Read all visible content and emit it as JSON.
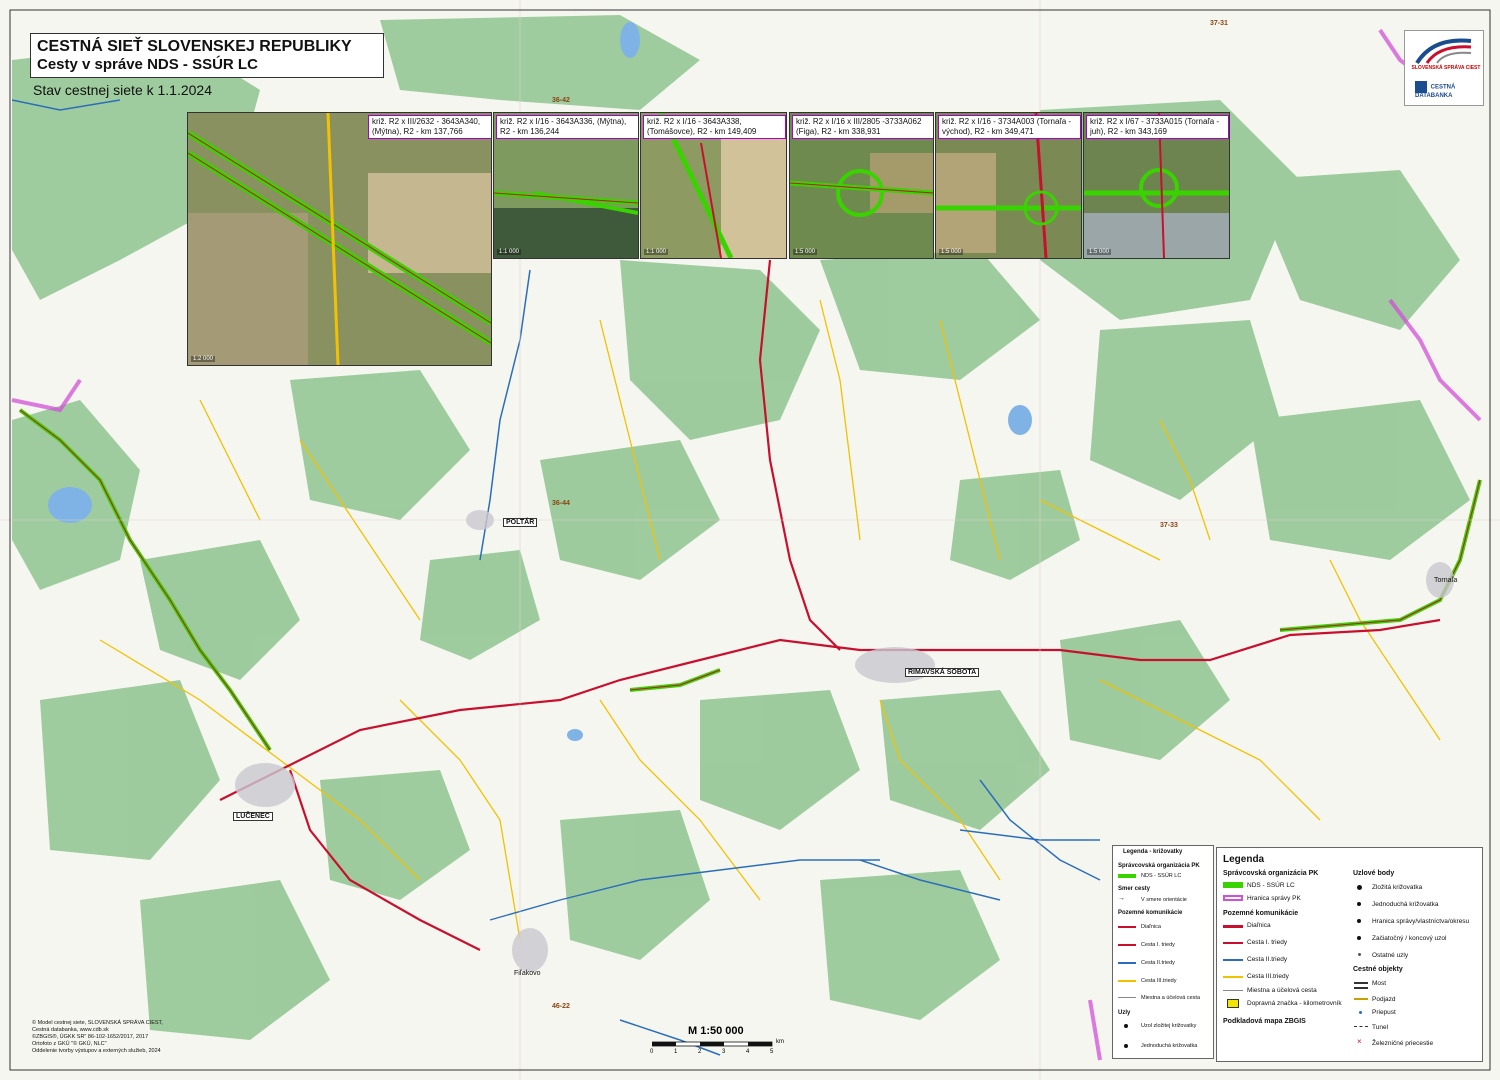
{
  "title": {
    "line1": "CESTNÁ SIEŤ SLOVENSKEJ REPUBLIKY",
    "line2": "Cesty v správe NDS - SSÚR LC",
    "status": "Stav cestnej siete k 1.1.2024"
  },
  "logos": {
    "ssc_text": "SLOVENSKÁ SPRÁVA CIEST",
    "cdb_text": "CESTNÁ DATABANKA"
  },
  "insets": [
    {
      "label": "križ. R2 x III/2632 - 3643A340, (Mýtna), R2 - km 137,766",
      "scale": "1:2 000"
    },
    {
      "label": "križ. R2 x I/16 - 3643A336, (Mýtna), R2 - km 136,244",
      "scale": "1:1 000"
    },
    {
      "label": "križ. R2 x I/16 - 3643A338, (Tomášovce), R2 - km 149,409",
      "scale": "1:1 000"
    },
    {
      "label": "križ. R2 x I/16 x III/2805 -3733A062 (Figa), R2 - km 338,931",
      "scale": "1:5 000"
    },
    {
      "label": "križ. R2 x I/16 - 3734A003 (Tornaľa - východ), R2 - km 349,471",
      "scale": "1:5 000"
    },
    {
      "label": "križ. R2 x I/67 - 3733A015 (Tornaľa - juh), R2 - km 343,169",
      "scale": "1:5 000"
    }
  ],
  "towns": {
    "poltar": "POLTÁR",
    "rimavska": "RIMAVSKÁ SOBOTA",
    "lucenec": "LUČENEC",
    "filakovo": "Fiľakovo",
    "tornala": "Tornaľa"
  },
  "grid_labels": [
    "36-42",
    "36-44",
    "37-31",
    "37-33",
    "46-22"
  ],
  "legend_small": {
    "title": "Legenda - križovatky",
    "org_header": "Správcovská organizácia PK",
    "org_item": "NDS - SSÚR LC",
    "dir_header": "Smer cesty",
    "dir_item": "V smere orientácie",
    "roads_header": "Pozemné komunikácie",
    "road_items": [
      "Diaľnica",
      "Cesta I. triedy",
      "Cesta II.triedy",
      "Cesta III.triedy",
      "Miestna a účelová cesta"
    ],
    "nodes_header": "Uzly",
    "node_items": [
      "Uzol zložitej križovatky",
      "Jednoduchá križovatka"
    ]
  },
  "legend_big": {
    "title": "Legenda",
    "org_header": "Správcovská organizácia PK",
    "org_items": [
      "NDS - SSÚR LC",
      "Hranica správy PK"
    ],
    "roads_header": "Pozemné komunikácie",
    "road_items": [
      "Diaľnica",
      "Cesta I. triedy",
      "Cesta II.triedy",
      "Cesta III.triedy",
      "Miestna a účelová cesta",
      "Dopravná značka - kilometrovník"
    ],
    "base_map": "Podkladová mapa ZBGIS",
    "nodes_header": "Uzlové body",
    "node_items": [
      "Zložitá križovatka",
      "Jednoduchá križovatka",
      "Hranica správy/vlastníctva/okresu",
      "Začiatočný / koncový uzol",
      "Ostatné uzly"
    ],
    "objects_header": "Cestné objekty",
    "object_items": [
      "Most",
      "Podjazd",
      "Priepust",
      "Tunel",
      "Železničné priecestie"
    ]
  },
  "copyright_lines": [
    "© Model cestnej siete, SLOVENSKÁ SPRÁVA CIEST,",
    "Cestná databanka, www.cdb.sk",
    "©ZBGIS®, ÚGKK SR\" 86-102-1652/2017, 2017",
    "Ortofoto z GKÚ \"© GKÚ, NLC\"",
    "Oddelenie tvorby výstupov a externých služieb, 2024"
  ],
  "scale": {
    "title": "M 1:50 000",
    "ticks": [
      "0",
      "1",
      "2",
      "3",
      "4",
      "5"
    ],
    "unit": "km"
  },
  "colors": {
    "forest": "#8fc48f",
    "nds_green": "#39d300",
    "road_red": "#c8102e",
    "road_yellow": "#f2c200",
    "boundary_pink": "#d24fd8",
    "water_blue": "#2a6ebb"
  }
}
